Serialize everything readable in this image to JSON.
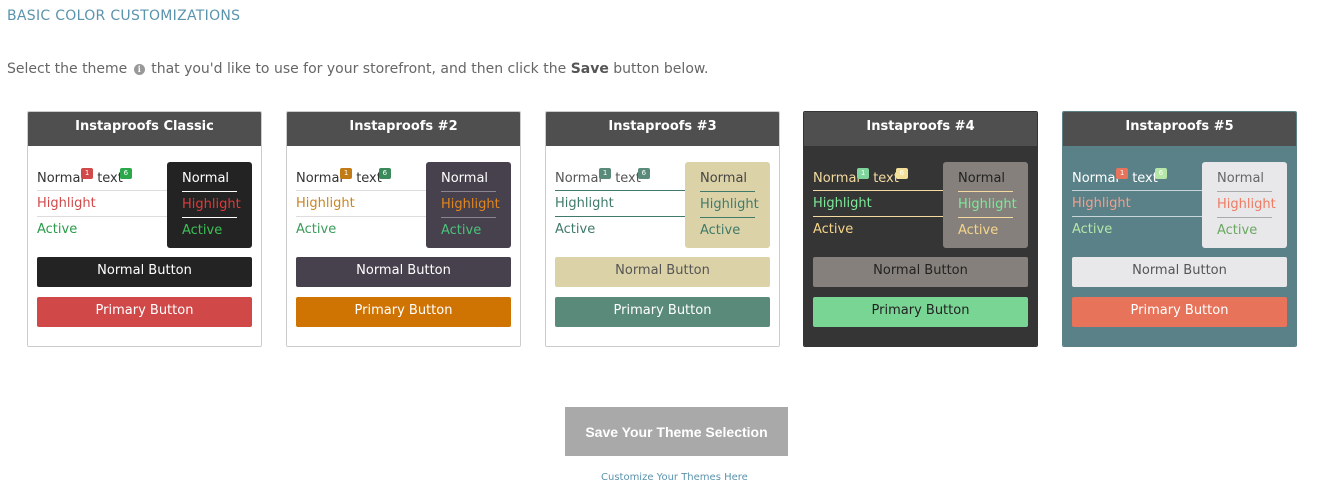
{
  "section": {
    "title": "BASIC COLOR CUSTOMIZATIONS"
  },
  "intro": {
    "before": "Select the theme",
    "info_icon": "info-icon",
    "after": "that you'd like to use for your storefront, and then click the",
    "bold": "Save",
    "end": "button below."
  },
  "themes": [
    {
      "name": "Instaproofs Classic",
      "normal": "Normal",
      "text": "text",
      "badge1": "1",
      "badge2": "6",
      "highlight": "Highlight",
      "active": "Active",
      "normal_button": "Normal Button",
      "primary_button": "Primary Button",
      "colors": {
        "body_bg": "#ffffff",
        "normal_text": "#333333",
        "highlight": "#d04a4a",
        "active": "#2a9b48",
        "divider": "#dddddd",
        "badge1": "#d04a4a",
        "badge2": "#2aa84a",
        "box_bg": "#232323",
        "box_normal": "#ffffff",
        "box_highlight": "#e03a3a",
        "box_active": "#3cc055",
        "box_line": "#ffffff",
        "normal_btn_bg": "#232323",
        "normal_btn_text": "#ffffff",
        "primary_btn_bg": "#d04848",
        "primary_btn_text": "#ffffff",
        "card_border": "#cccccc"
      }
    },
    {
      "name": "Instaproofs #2",
      "normal": "Normal",
      "text": "text",
      "badge1": "1",
      "badge2": "6",
      "highlight": "Highlight",
      "active": "Active",
      "normal_button": "Normal Button",
      "primary_button": "Primary Button",
      "colors": {
        "body_bg": "#ffffff",
        "normal_text": "#333333",
        "highlight": "#c98522",
        "active": "#3a9b5a",
        "divider": "#dddddd",
        "badge1": "#c27a14",
        "badge2": "#3a8a5a",
        "box_bg": "#46414d",
        "box_normal": "#ffffff",
        "box_highlight": "#e2861d",
        "box_active": "#4cc27a",
        "box_line": "#8a8590",
        "normal_btn_bg": "#46414d",
        "normal_btn_text": "#ffffff",
        "primary_btn_bg": "#cf7303",
        "primary_btn_text": "#ffffff",
        "card_border": "#cccccc"
      }
    },
    {
      "name": "Instaproofs #3",
      "normal": "Normal",
      "text": "text",
      "badge1": "1",
      "badge2": "6",
      "highlight": "Highlight",
      "active": "Active",
      "normal_button": "Normal Button",
      "primary_button": "Primary Button",
      "colors": {
        "body_bg": "#ffffff",
        "normal_text": "#555555",
        "highlight": "#3f7a6a",
        "active": "#3f7a6a",
        "divider": "#3f7a6a",
        "badge1": "#5a8a7a",
        "badge2": "#5a8a7a",
        "box_bg": "#dcd2a8",
        "box_normal": "#444444",
        "box_highlight": "#3f7a6a",
        "box_active": "#3f7a6a",
        "box_line": "#3f7a6a",
        "normal_btn_bg": "#dcd2a8",
        "normal_btn_text": "#555555",
        "primary_btn_bg": "#5a8a7a",
        "primary_btn_text": "#ffffff",
        "card_border": "#cccccc"
      }
    },
    {
      "name": "Instaproofs #4",
      "normal": "Normal",
      "text": "text",
      "badge1": "1",
      "badge2": "6",
      "highlight": "Highlight",
      "active": "Active",
      "normal_button": "Normal Button",
      "primary_button": "Primary Button",
      "colors": {
        "body_bg": "#353535",
        "normal_text": "#f3dba0",
        "highlight": "#7ee89a",
        "active": "#f6d58a",
        "divider": "#f3dba0",
        "badge1": "#7ed49a",
        "badge2": "#f3e098",
        "box_bg": "#85807b",
        "box_normal": "#222222",
        "box_highlight": "#7ee89a",
        "box_active": "#f6d58a",
        "box_line": "#f3dba0",
        "normal_btn_bg": "#85807b",
        "normal_btn_text": "#222222",
        "primary_btn_bg": "#78d594",
        "primary_btn_text": "#222222",
        "card_border": "#353535"
      }
    },
    {
      "name": "Instaproofs #5",
      "normal": "Normal",
      "text": "text",
      "badge1": "1",
      "badge2": "6",
      "highlight": "Highlight",
      "active": "Active",
      "normal_button": "Normal Button",
      "primary_button": "Primary Button",
      "colors": {
        "body_bg": "#5a8188",
        "normal_text": "#ffffff",
        "highlight": "#f2a08c",
        "active": "#b6e6a8",
        "divider": "#c7d6d8",
        "badge1": "#e7735a",
        "badge2": "#b6e6a8",
        "box_bg": "#e8e8ea",
        "box_normal": "#666666",
        "box_highlight": "#ef7c62",
        "box_active": "#6aa860",
        "box_line": "#aaaaaa",
        "normal_btn_bg": "#e8e8ea",
        "normal_btn_text": "#555555",
        "primary_btn_bg": "#e7735a",
        "primary_btn_text": "#ffffff",
        "card_border": "#5a8188"
      }
    }
  ],
  "save_button": "Save Your Theme Selection",
  "customize_link": "Customize Your Themes Here"
}
